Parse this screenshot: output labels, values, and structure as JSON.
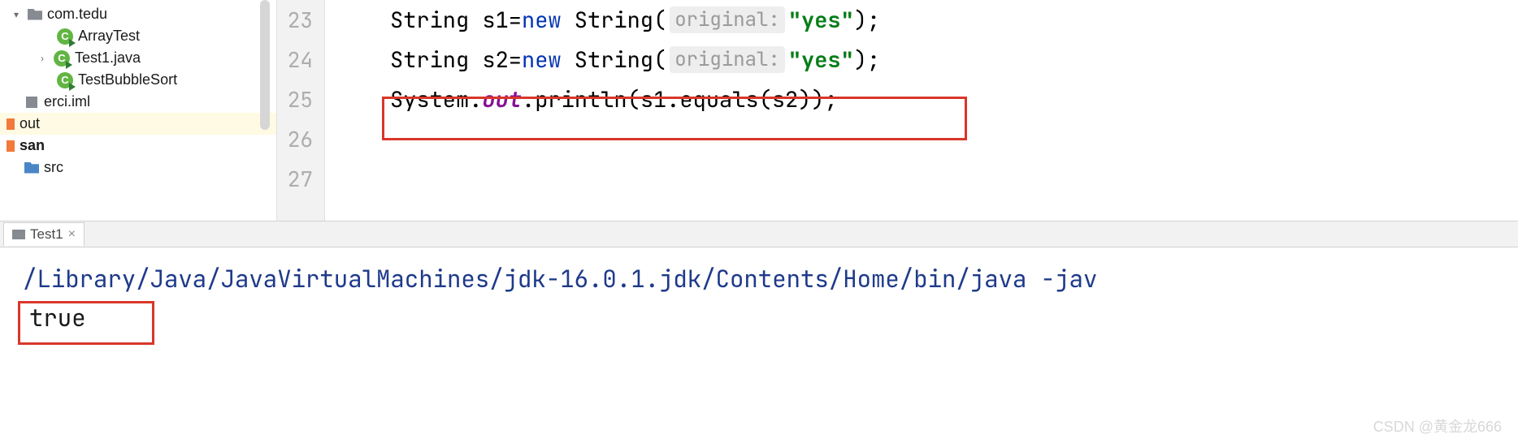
{
  "project": {
    "pkg": "com.tedu",
    "items": [
      "ArrayTest",
      "Test1.java",
      "TestBubbleSort"
    ],
    "iml": "erci.iml",
    "out": "out",
    "san": "san",
    "src": "src"
  },
  "editor": {
    "lines": [
      "23",
      "24",
      "25",
      "26",
      "27"
    ],
    "code": {
      "l23": {
        "pre": "String s1=",
        "kw": "new",
        "cls": " String(",
        "hint": "original:",
        "str": "\"yes\"",
        "post": ");"
      },
      "l24": {
        "pre": "String s2=",
        "kw": "new",
        "cls": " String(",
        "hint": "original:",
        "str": "\"yes\"",
        "post": ");"
      },
      "l25": {
        "sys": "System.",
        "out": "out",
        "call": ".println(s1.equals(s2));"
      }
    }
  },
  "run": {
    "tab": "Test1",
    "cmd": "/Library/Java/JavaVirtualMachines/jdk-16.0.1.jdk/Contents/Home/bin/java -jav",
    "output": "true"
  },
  "watermark": "CSDN @黄金龙666"
}
